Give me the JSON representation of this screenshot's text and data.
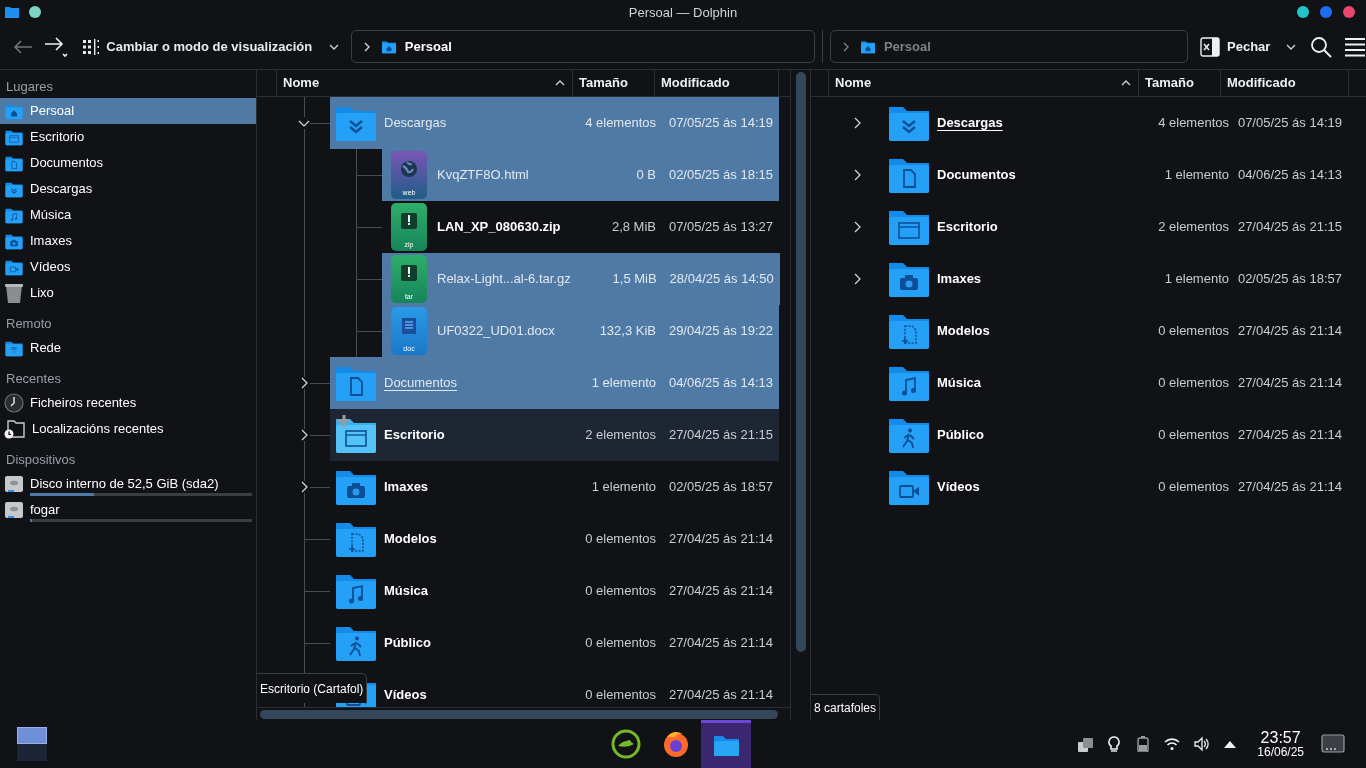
{
  "window": {
    "title": "Persoal — Dolphin"
  },
  "toolbar": {
    "view_mode_button": "Cambiar o modo de visualización",
    "close_button": "Pechar"
  },
  "breadcrumbs": [
    {
      "label": "Persoal",
      "active": true
    },
    {
      "label": "Persoal",
      "active": false
    }
  ],
  "sidebar": {
    "sections": [
      {
        "title": "Lugares",
        "items": [
          {
            "label": "Persoal",
            "selected": true
          },
          {
            "label": "Escritorio",
            "selected": false
          },
          {
            "label": "Documentos",
            "selected": false
          },
          {
            "label": "Descargas",
            "selected": false
          },
          {
            "label": "Música",
            "selected": false
          },
          {
            "label": "Imaxes",
            "selected": false
          },
          {
            "label": "Vídeos",
            "selected": false
          },
          {
            "label": "Lixo",
            "selected": false
          }
        ]
      },
      {
        "title": "Remoto",
        "items": [
          {
            "label": "Rede",
            "selected": false
          }
        ]
      },
      {
        "title": "Recentes",
        "items": [
          {
            "label": "Ficheiros recentes",
            "selected": false
          },
          {
            "label": "Localizacións recentes",
            "selected": false
          }
        ]
      },
      {
        "title": "Dispositivos",
        "items": [
          {
            "label": "Disco interno de 52,5 GiB (sda2)",
            "selected": false,
            "level": 0.29
          },
          {
            "label": "fogar",
            "selected": false,
            "level": 0.01
          }
        ]
      }
    ]
  },
  "left_pane": {
    "columns": [
      "Nome",
      "Tamaño",
      "Modificado"
    ],
    "rows": [
      {
        "kind": "folder",
        "name": "Descargas",
        "size": "4 elementos",
        "modified": "07/05/25 ás 14:19",
        "selected": true,
        "hovered": false,
        "current": false,
        "expanded": true,
        "children": [
          {
            "kind": "file",
            "name": "KvqZTF8O.html",
            "size": "0 B",
            "modified": "02/05/25 ás 18:15",
            "type_label": "web",
            "selected": true,
            "hovered": false,
            "current": false
          },
          {
            "kind": "file",
            "name": "LAN_XP_080630.zip",
            "size": "2,8 MiB",
            "modified": "07/05/25 ás 13:27",
            "type_label": "zip",
            "selected": false,
            "hovered": false,
            "current": false
          },
          {
            "kind": "file",
            "name": "Relax-Light...al-6.tar.gz",
            "size": "1,5 MiB",
            "modified": "28/04/25 ás 14:50",
            "type_label": "tar",
            "selected": true,
            "hovered": false,
            "current": false
          },
          {
            "kind": "file",
            "name": "UF0322_UD01.docx",
            "size": "132,3 KiB",
            "modified": "29/04/25 ás 19:22",
            "type_label": "doc",
            "selected": true,
            "hovered": false,
            "current": false
          }
        ]
      },
      {
        "kind": "folder",
        "name": "Documentos",
        "size": "1 elemento",
        "modified": "04/06/25 ás 14:13",
        "selected": true,
        "hovered": false,
        "current": true,
        "expanded": false
      },
      {
        "kind": "folder",
        "name": "Escritorio",
        "size": "2 elementos",
        "modified": "27/04/25 ás 21:15",
        "selected": false,
        "hovered": true,
        "current": false,
        "expanded": false
      },
      {
        "kind": "folder",
        "name": "Imaxes",
        "size": "1 elemento",
        "modified": "02/05/25 ás 18:57",
        "selected": false,
        "hovered": false,
        "current": false,
        "expanded": false
      },
      {
        "kind": "folder",
        "name": "Modelos",
        "size": "0 elementos",
        "modified": "27/04/25 ás 21:14",
        "selected": false,
        "hovered": false,
        "current": false
      },
      {
        "kind": "folder",
        "name": "Música",
        "size": "0 elementos",
        "modified": "27/04/25 ás 21:14",
        "selected": false,
        "hovered": false,
        "current": false
      },
      {
        "kind": "folder",
        "name": "Público",
        "size": "0 elementos",
        "modified": "27/04/25 ás 21:14",
        "selected": false,
        "hovered": false,
        "current": false
      },
      {
        "kind": "folder",
        "name": "Vídeos",
        "size": "0 elementos",
        "modified": "27/04/25 ás 21:14",
        "selected": false,
        "hovered": false,
        "current": false
      }
    ],
    "status": "Escritorio (Cartafol)"
  },
  "right_pane": {
    "columns": [
      "Nome",
      "Tamaño",
      "Modificado"
    ],
    "rows": [
      {
        "kind": "folder",
        "name": "Descargas",
        "size": "4 elementos",
        "modified": "07/05/25 ás 14:19",
        "selected": false,
        "current": true,
        "expanded": false
      },
      {
        "kind": "folder",
        "name": "Documentos",
        "size": "1 elemento",
        "modified": "04/06/25 ás 14:13",
        "selected": false,
        "current": false,
        "expanded": false
      },
      {
        "kind": "folder",
        "name": "Escritorio",
        "size": "2 elementos",
        "modified": "27/04/25 ás 21:15",
        "selected": false,
        "current": false,
        "expanded": false
      },
      {
        "kind": "folder",
        "name": "Imaxes",
        "size": "1 elemento",
        "modified": "02/05/25 ás 18:57",
        "selected": false,
        "current": false,
        "expanded": false
      },
      {
        "kind": "folder",
        "name": "Modelos",
        "size": "0 elementos",
        "modified": "27/04/25 ás 21:14",
        "selected": false,
        "current": false
      },
      {
        "kind": "folder",
        "name": "Música",
        "size": "0 elementos",
        "modified": "27/04/25 ás 21:14",
        "selected": false,
        "current": false
      },
      {
        "kind": "folder",
        "name": "Público",
        "size": "0 elementos",
        "modified": "27/04/25 ás 21:14",
        "selected": false,
        "current": false
      },
      {
        "kind": "folder",
        "name": "Vídeos",
        "size": "0 elementos",
        "modified": "27/04/25 ás 21:14",
        "selected": false,
        "current": false
      }
    ],
    "status": "8 cartafoles"
  },
  "taskbar": {
    "apps": [
      {
        "selected": false
      },
      {
        "selected": false
      },
      {
        "selected": true
      }
    ],
    "clock": {
      "time": "23:57",
      "date": "16/06/25"
    }
  }
}
